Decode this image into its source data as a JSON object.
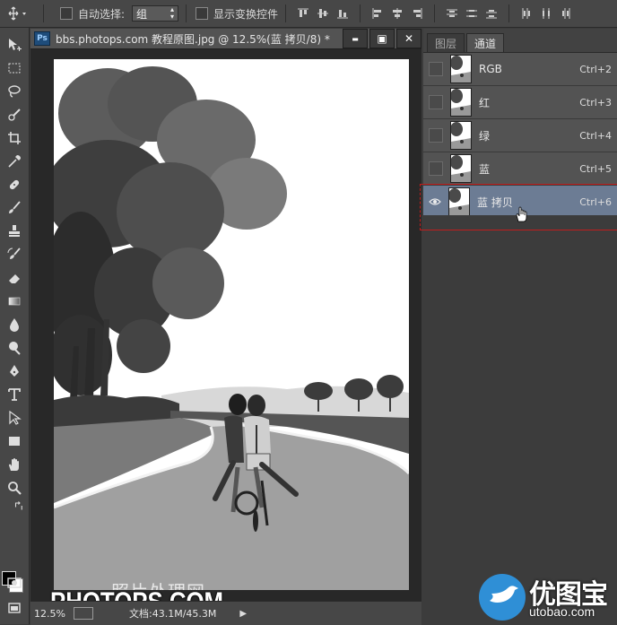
{
  "options_bar": {
    "auto_select_label": "自动选择:",
    "auto_select_value": "组",
    "show_transform_label": "显示变换控件"
  },
  "document": {
    "app_badge": "Ps",
    "title": "bbs.photops.com 教程原图.jpg @ 12.5%(蓝 拷贝/8) *",
    "window_buttons": {
      "minimize": "▬",
      "restore": "▣",
      "close": "✕"
    },
    "zoom": "12.5%",
    "doc_info": "文档:43.1M/45.3M",
    "watermark_cn": "照片处理网",
    "watermark_en": "PHOTOPS.COM"
  },
  "panel": {
    "tabs": [
      {
        "label": "图层",
        "active": false
      },
      {
        "label": "通道",
        "active": true
      }
    ],
    "channels": [
      {
        "name": "RGB",
        "shortcut": "Ctrl+2",
        "visible": false,
        "active": false
      },
      {
        "name": "红",
        "shortcut": "Ctrl+3",
        "visible": false,
        "active": false
      },
      {
        "name": "绿",
        "shortcut": "Ctrl+4",
        "visible": false,
        "active": false
      },
      {
        "name": "蓝",
        "shortcut": "Ctrl+5",
        "visible": false,
        "active": false
      },
      {
        "name": "蓝 拷贝",
        "shortcut": "Ctrl+6",
        "visible": true,
        "active": true
      }
    ]
  },
  "logo": {
    "cn": "优图宝",
    "url": "utobao.com"
  },
  "colors": {
    "highlight": "#6c7c94",
    "annotation_red": "#c21d1d",
    "logo_blue": "#2f8fd6"
  }
}
